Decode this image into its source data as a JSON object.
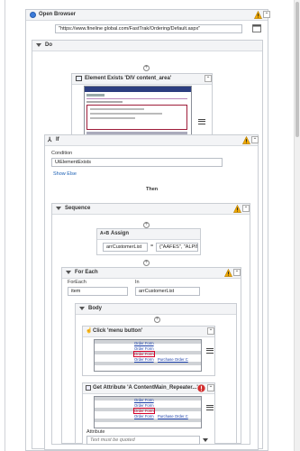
{
  "open_browser": {
    "title": "Open Browser",
    "url": "\"https://www.fineline global.com/FastTrak/Ordering/Default.aspx\""
  },
  "do": {
    "title": "Do"
  },
  "element_exists": {
    "title": "Element Exists 'DIV  content_area'"
  },
  "if": {
    "title": "If",
    "condition_label": "Condition",
    "condition_value": "UiElementExists",
    "show_else": "Show Else",
    "then_label": "Then"
  },
  "sequence": {
    "title": "Sequence"
  },
  "assign": {
    "title": "Assign",
    "to": "arrCustomerList",
    "eq": "=",
    "value": "{\"AAFES\", \"ALPINE:"
  },
  "for_each": {
    "title": "For Each",
    "foreach_label": "ForEach",
    "item_value": "item",
    "in_label": "In",
    "in_value": "arrCustomerList"
  },
  "body": {
    "title": "Body"
  },
  "click": {
    "title": "Click 'menu button'",
    "links": [
      "Order Form",
      "Order Form",
      "Order Form",
      "Purchase Order C"
    ]
  },
  "get_attribute": {
    "title": "Get Attribute 'A  ContentMain_Repeater...'",
    "links": [
      "Order Form",
      "Order Form",
      "Order Form",
      "Purchase Order C"
    ],
    "attribute_label": "Attribute",
    "attribute_placeholder": "Text must be quoted"
  },
  "colors": {
    "warning": "#f0a800",
    "error": "#d32f2f",
    "link": "#1a5fb4",
    "selected_outline": "#d4002a"
  }
}
